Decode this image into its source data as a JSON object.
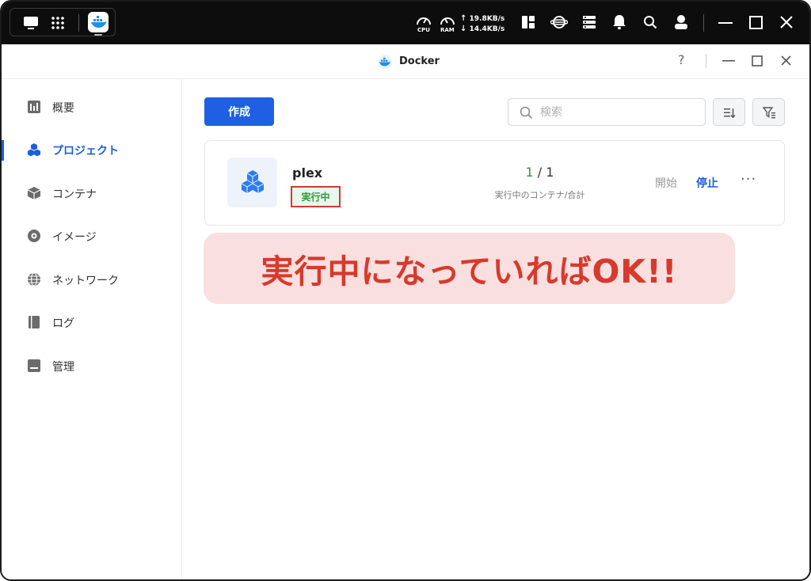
{
  "system_bar": {
    "cpu_label": "CPU",
    "ram_label": "RAM",
    "upload_speed": "19.8KB/s",
    "download_speed": "14.4KB/s"
  },
  "window": {
    "title": "Docker",
    "help": "?"
  },
  "sidebar": {
    "items": [
      {
        "label": "概要",
        "icon": "overview-icon"
      },
      {
        "label": "プロジェクト",
        "icon": "project-icon",
        "active": true
      },
      {
        "label": "コンテナ",
        "icon": "container-icon"
      },
      {
        "label": "イメージ",
        "icon": "image-icon"
      },
      {
        "label": "ネットワーク",
        "icon": "network-icon"
      },
      {
        "label": "ログ",
        "icon": "log-icon"
      },
      {
        "label": "管理",
        "icon": "manage-icon"
      }
    ]
  },
  "toolbar": {
    "create_label": "作成",
    "search_placeholder": "検索"
  },
  "project": {
    "name": "plex",
    "status": "実行中",
    "running": "1",
    "separator": "/",
    "total": "1",
    "count_label": "実行中のコンテナ/合計",
    "start_label": "開始",
    "stop_label": "停止",
    "more_label": "···"
  },
  "annotation": {
    "text": "実行中になっていればOK!!"
  },
  "colors": {
    "accent": "#1f5fe3",
    "running": "#2e9a3c",
    "annotation_text": "#d63a2c",
    "annotation_bg": "#f9dfdf"
  }
}
